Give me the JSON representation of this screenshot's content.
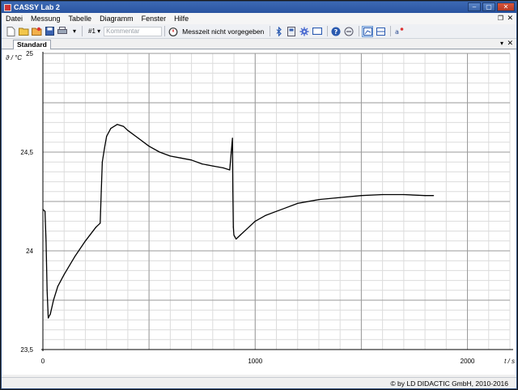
{
  "window": {
    "title": "CASSY Lab 2"
  },
  "menu": {
    "items": [
      "Datei",
      "Messung",
      "Tabelle",
      "Diagramm",
      "Fenster",
      "Hilfe"
    ]
  },
  "toolbar": {
    "channel_select": "#1",
    "comment_placeholder": "Kommentar",
    "measurement_time": "Messzeit nicht vorgegeben"
  },
  "tabs": {
    "active": "Standard"
  },
  "status": {
    "copyright": "© by LD DIDACTIC GmbH, 2010-2016"
  },
  "chart_data": {
    "type": "line",
    "title": "",
    "xlabel": "t / s",
    "ylabel": "ϑ / °C",
    "xlim": [
      0,
      2200
    ],
    "ylim": [
      23.5,
      25
    ],
    "grid": true,
    "xticks": [
      0,
      1000,
      2000
    ],
    "xtick_labels": [
      "0",
      "1000",
      "2000"
    ],
    "yticks": [
      23.5,
      24,
      24.5,
      25
    ],
    "ytick_labels": [
      "23,5",
      "24",
      "24,5",
      "25"
    ],
    "series": [
      {
        "color": "#000000",
        "x": [
          0,
          10,
          15,
          20,
          25,
          35,
          50,
          70,
          100,
          150,
          200,
          250,
          270,
          275,
          280,
          290,
          300,
          320,
          350,
          380,
          400,
          450,
          500,
          550,
          600,
          650,
          700,
          750,
          800,
          850,
          880,
          893,
          895,
          897,
          900,
          910,
          930,
          960,
          1000,
          1050,
          1100,
          1150,
          1200,
          1300,
          1400,
          1500,
          1600,
          1700,
          1800,
          1840
        ],
        "y": [
          24.21,
          24.2,
          24.05,
          23.8,
          23.66,
          23.68,
          23.75,
          23.82,
          23.88,
          23.97,
          24.05,
          24.12,
          24.14,
          24.3,
          24.45,
          24.52,
          24.58,
          24.62,
          24.64,
          24.63,
          24.61,
          24.57,
          24.53,
          24.5,
          24.48,
          24.47,
          24.46,
          24.44,
          24.43,
          24.42,
          24.41,
          24.57,
          24.3,
          24.12,
          24.08,
          24.06,
          24.08,
          24.11,
          24.15,
          24.18,
          24.2,
          24.22,
          24.24,
          24.26,
          24.27,
          24.28,
          24.285,
          24.285,
          24.28,
          24.28
        ]
      }
    ]
  }
}
